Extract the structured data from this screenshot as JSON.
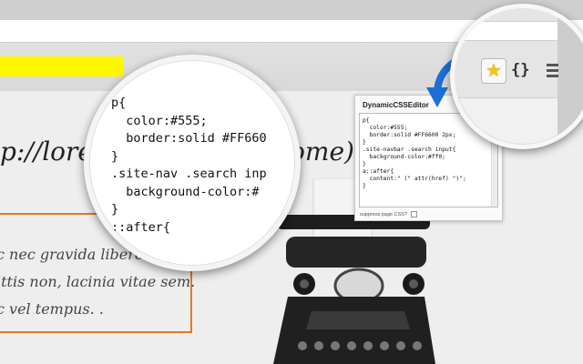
{
  "page": {
    "url_heading": "p://lore",
    "url_heading_tail": "home)",
    "quote_lines": [
      "c nec gravida libero.",
      "ittis non, lacinia vitae sem.",
      "c vel tempus. ."
    ]
  },
  "magnifier": {
    "code": "p{\n  color:#555;\n  border:solid #FF660\n}\n.site-nav .search inp\n  background-color:#\n}\n::after{"
  },
  "editor": {
    "title": "DynamicCSSEditor",
    "code": "p{\n  color:#555;\n  border:solid #FF6600 2px;\n}\n.site-navbar .search input{\n  background-color:#ff0;\n}\na::after{\n  content:\" (\" attr(href) \")\";\n}",
    "suppress_label": "suppress page CSS?"
  },
  "toolbar": {
    "braces_label": "{}",
    "star_icon": "star-icon",
    "menu_icon": "menu-icon"
  },
  "colors": {
    "highlight_yellow": "#fff700",
    "border_orange": "#e07a20",
    "arrow_blue": "#1d6fd8",
    "star_gold": "#f0c419"
  }
}
